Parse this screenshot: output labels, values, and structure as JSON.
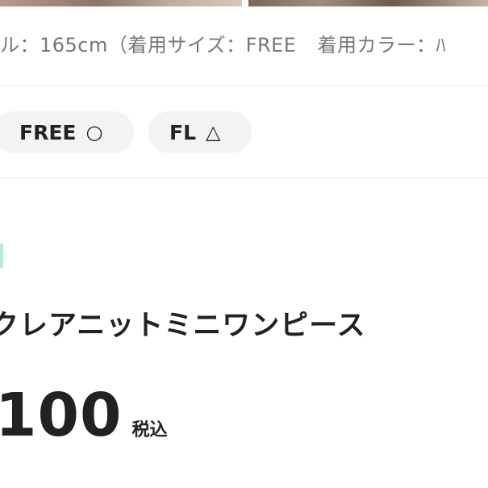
{
  "model_info": {
    "height": "ル：165cm（着用サイズ：FREE",
    "color": "着用カラー：ﾊ"
  },
  "sizes": [
    {
      "label": "FREE",
      "stock_mark": "○"
    },
    {
      "label": "FL",
      "stock_mark": "△"
    }
  ],
  "product": {
    "name": "クレアニットミニワンピース",
    "price": "100",
    "tax_label": "税込"
  }
}
